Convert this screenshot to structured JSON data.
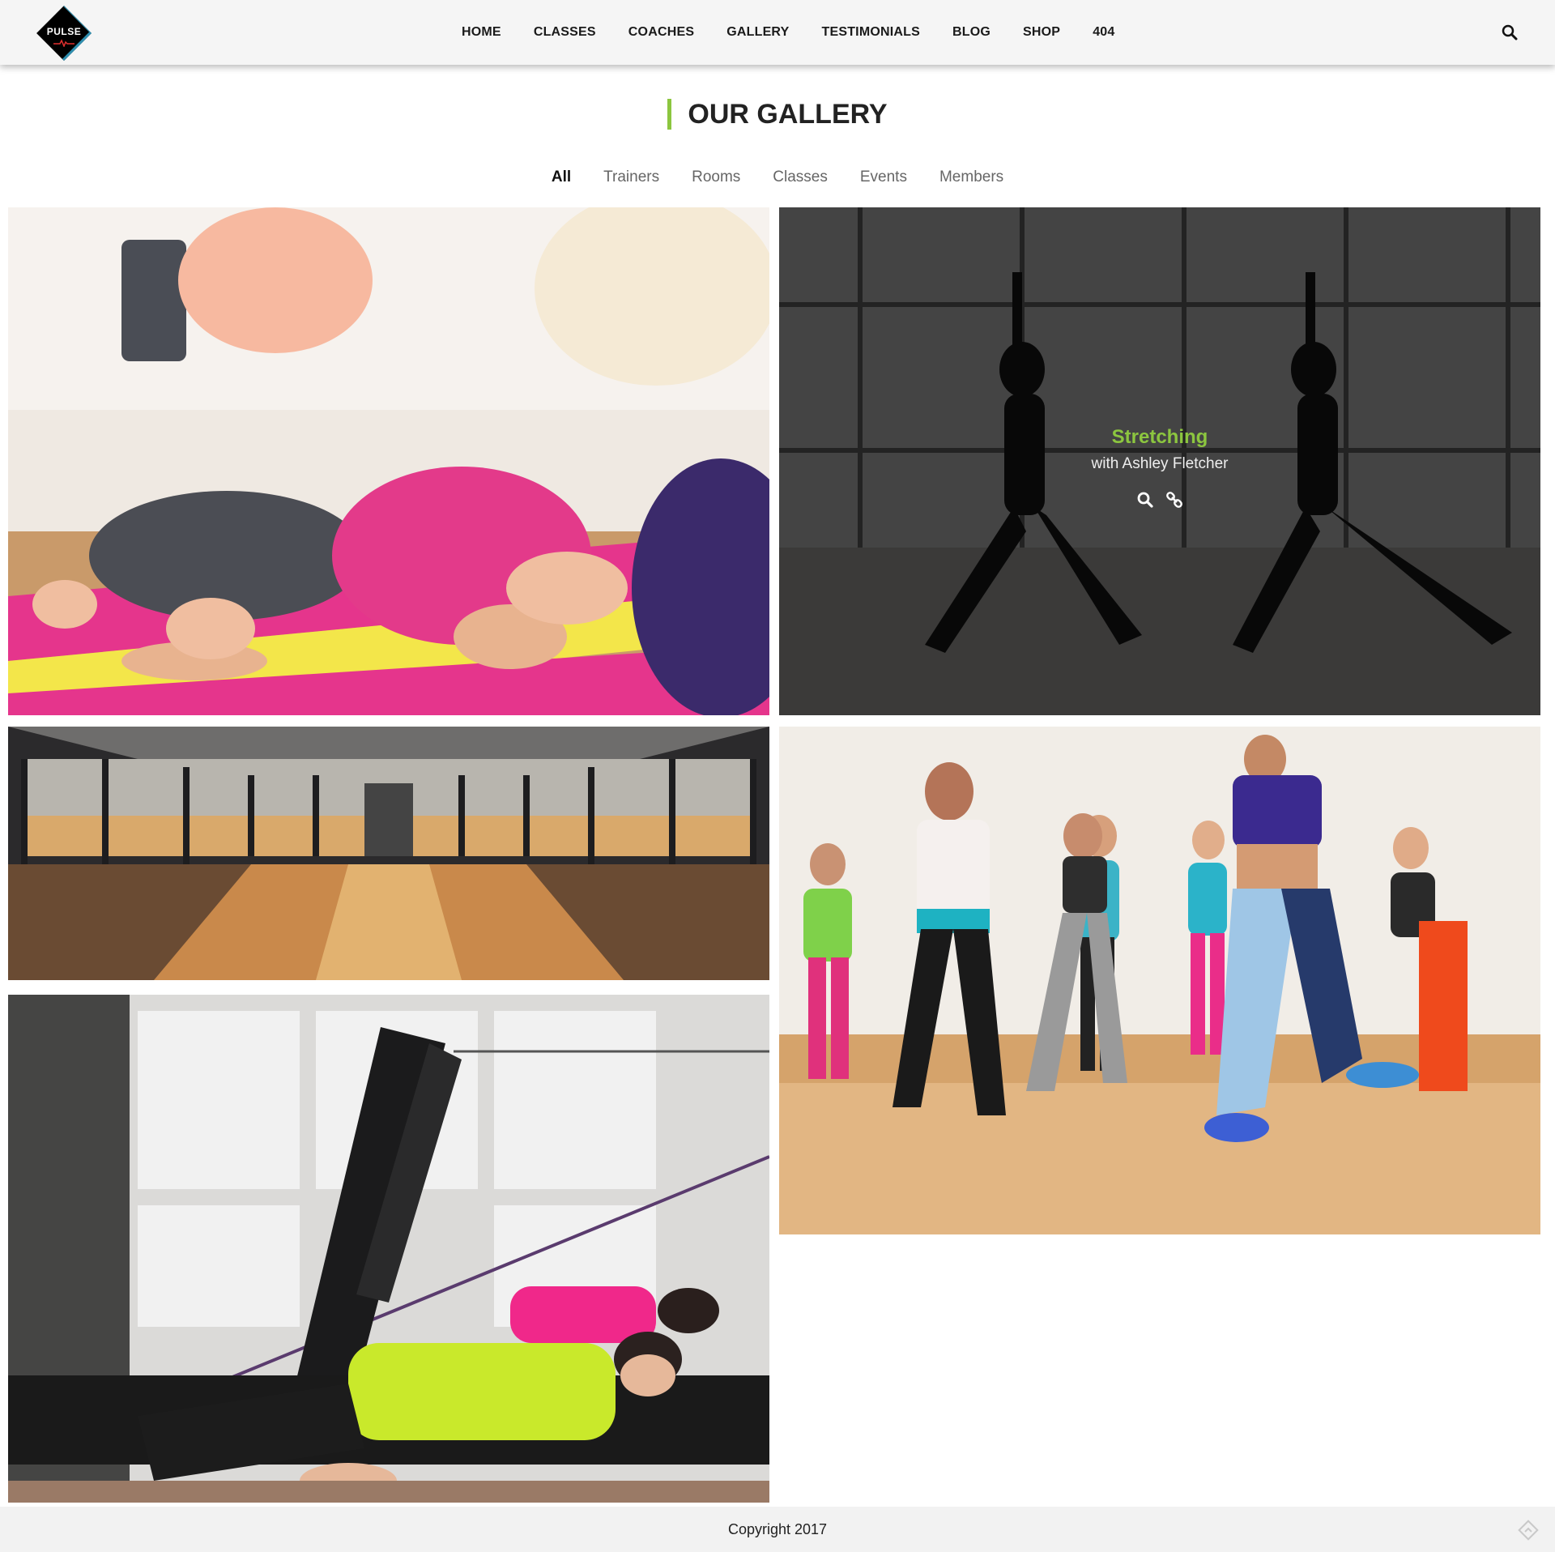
{
  "brand": {
    "logo_text": "PULSE"
  },
  "nav": {
    "items": [
      "HOME",
      "CLASSES",
      "COACHES",
      "GALLERY",
      "TESTIMONIALS",
      "BLOG",
      "SHOP",
      "404"
    ]
  },
  "gallery": {
    "title": "OUR GALLERY",
    "filters": [
      "All",
      "Trainers",
      "Rooms",
      "Classes",
      "Events",
      "Members"
    ],
    "active_filter": "All",
    "hover_item": {
      "title": "Stretching",
      "subtitle": "with Ashley Fletcher"
    },
    "items": [
      {
        "icon": "yoga-meditation-photo"
      },
      {
        "icon": "stretching-photo"
      },
      {
        "icon": "gym-room-photo"
      },
      {
        "icon": "dance-class-photo"
      },
      {
        "icon": "pilates-reformer-photo"
      }
    ]
  },
  "footer": {
    "copyright": "Copyright 2017"
  },
  "colors": {
    "accent": "#8cc63f",
    "header_bg": "#f5f5f5",
    "footer_bg": "#f2f2f2"
  }
}
